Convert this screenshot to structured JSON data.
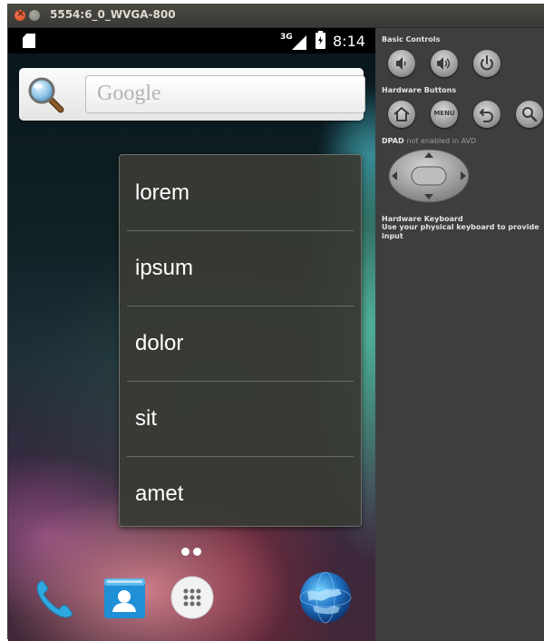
{
  "window": {
    "title": "5554:6_0_WVGA-800"
  },
  "statusbar": {
    "network": "3G",
    "time": "8:14"
  },
  "search": {
    "placeholder": "Google"
  },
  "popup_menu": {
    "items": [
      "lorem",
      "ipsum",
      "dolor",
      "sit",
      "amet"
    ]
  },
  "launcher": {
    "page_count": 2,
    "dock": [
      "phone-icon",
      "contacts-icon",
      "app-drawer-icon",
      "browser-globe-icon"
    ]
  },
  "controls_panel": {
    "basic_controls_label": "Basic Controls",
    "hardware_buttons_label": "Hardware Buttons",
    "menu_button_label": "MENU",
    "dpad_label": "DPAD",
    "dpad_status": "not enabled in AVD",
    "keyboard_label": "Hardware Keyboard",
    "keyboard_note": "Use your physical keyboard to provide input"
  }
}
